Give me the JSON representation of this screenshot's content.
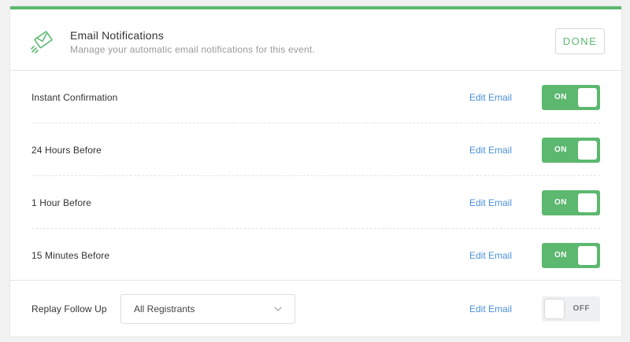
{
  "header": {
    "title": "Email Notifications",
    "subtitle": "Manage your automatic email notifications for this event.",
    "done_label": "DONE",
    "icon": "envelope-send-icon"
  },
  "notifications": [
    {
      "label": "Instant Confirmation",
      "edit_label": "Edit Email",
      "state": "ON"
    },
    {
      "label": "24 Hours Before",
      "edit_label": "Edit Email",
      "state": "ON"
    },
    {
      "label": "1 Hour Before",
      "edit_label": "Edit Email",
      "state": "ON"
    },
    {
      "label": "15 Minutes Before",
      "edit_label": "Edit Email",
      "state": "ON"
    }
  ],
  "follow_up": {
    "label": "Replay Follow Up",
    "select_value": "All Registrants",
    "edit_label": "Edit Email",
    "state": "OFF"
  },
  "colors": {
    "accent": "#5cb86f",
    "link": "#4a90d9",
    "toggle_off_bg": "#eef0f1"
  }
}
